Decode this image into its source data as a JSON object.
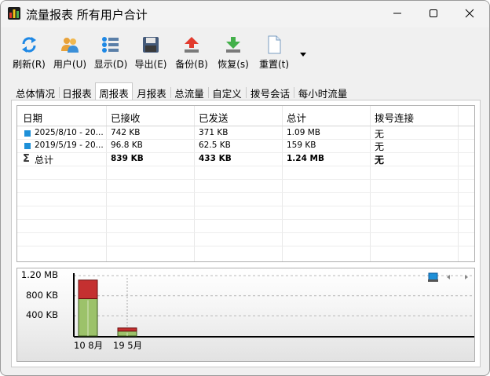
{
  "window": {
    "title": "流量报表 所有用户合计",
    "controls": {
      "minimize": "minimize",
      "maximize": "maximize",
      "close": "close"
    }
  },
  "toolbar": {
    "buttons": [
      {
        "label": "刷新(R)",
        "icon": "refresh-icon"
      },
      {
        "label": "用户(U)",
        "icon": "users-icon"
      },
      {
        "label": "显示(D)",
        "icon": "display-list-icon"
      },
      {
        "label": "导出(E)",
        "icon": "floppy-disk-icon"
      },
      {
        "label": "备份(B)",
        "icon": "upload-arrow-icon"
      },
      {
        "label": "恢复(s)",
        "icon": "download-arrow-icon"
      },
      {
        "label": "重置(t)",
        "icon": "document-icon"
      }
    ]
  },
  "tabs": [
    {
      "label": "总体情况"
    },
    {
      "label": "日报表"
    },
    {
      "label": "周报表",
      "active": true
    },
    {
      "label": "月报表"
    },
    {
      "label": "总流量"
    },
    {
      "label": "自定义"
    },
    {
      "label": "拨号会话"
    },
    {
      "label": "每小时流量"
    }
  ],
  "table": {
    "headers": [
      "日期",
      "已接收",
      "已发送",
      "总计",
      "拨号连接"
    ],
    "rows": [
      {
        "date": "2025/8/10 - 20...",
        "received": "742 KB",
        "sent": "371 KB",
        "total": "1.09 MB",
        "dial": "无"
      },
      {
        "date": "2019/5/19 - 20...",
        "received": "96.8 KB",
        "sent": "62.5 KB",
        "total": "159 KB",
        "dial": "无"
      }
    ],
    "summary": {
      "symbol": "Σ",
      "date": "总计",
      "received": "839 KB",
      "sent": "433 KB",
      "total": "1.24 MB",
      "dial": "无"
    }
  },
  "chart_data": {
    "type": "bar",
    "stacked": true,
    "categories": [
      "10 8月",
      "19 5月"
    ],
    "series": [
      {
        "values": [
          371,
          62.5
        ],
        "color": "#c43030"
      },
      {
        "values": [
          742,
          96.8
        ],
        "color": "#9cc26a"
      }
    ],
    "y_ticks": [
      "1.20 MB",
      "800 KB",
      "400 KB"
    ],
    "y_tick_values": [
      1200,
      800,
      400
    ],
    "ylim": [
      0,
      1250
    ],
    "grid": true,
    "legend_placement": "top-right",
    "legend_icon_color": "#1e90d8"
  }
}
